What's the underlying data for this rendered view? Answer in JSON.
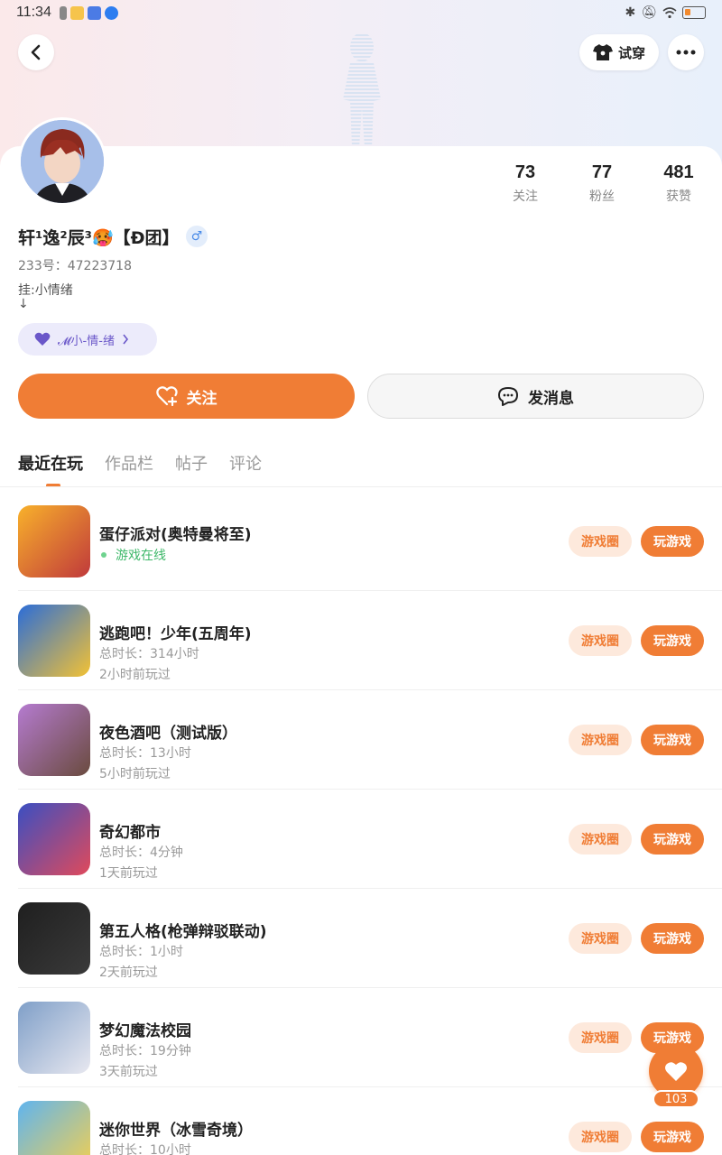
{
  "status_bar": {
    "time": "11:34"
  },
  "header": {
    "tryon_label": "试穿"
  },
  "profile": {
    "stats": [
      {
        "value": "73",
        "label": "关注"
      },
      {
        "value": "77",
        "label": "粉丝"
      },
      {
        "value": "481",
        "label": "获赞"
      }
    ],
    "username": "轩¹逸²辰³🥵【Đ团】",
    "gender_symbol": "♂",
    "uid_label": "233号：",
    "uid": "47223718",
    "bio_line1": "挂:小情绪",
    "bio_line2": "↓",
    "tag": "𝓜小-情-绪"
  },
  "actions": {
    "follow_label": "关注",
    "message_label": "发消息"
  },
  "tabs": [
    {
      "label": "最近在玩",
      "active": true
    },
    {
      "label": "作品栏",
      "active": false
    },
    {
      "label": "帖子",
      "active": false
    },
    {
      "label": "评论",
      "active": false
    }
  ],
  "games": [
    {
      "title": "蛋仔派对(奥特曼将至)",
      "online": "游戏在线",
      "sub1": "",
      "sub2": "",
      "colors": [
        "#f8b12b",
        "#c0393b"
      ]
    },
    {
      "title": "逃跑吧！少年(五周年)",
      "online": "",
      "sub1": "总时长：314小时",
      "sub2": "2小时前玩过",
      "colors": [
        "#2b6dd8",
        "#f3c234"
      ]
    },
    {
      "title": "夜色酒吧（测试版）",
      "online": "",
      "sub1": "总时长：13小时",
      "sub2": "5小时前玩过",
      "colors": [
        "#b57bd0",
        "#6a4b3e"
      ]
    },
    {
      "title": "奇幻都市",
      "online": "",
      "sub1": "总时长：4分钟",
      "sub2": "1天前玩过",
      "colors": [
        "#3a4fc2",
        "#e04a5b"
      ]
    },
    {
      "title": "第五人格(枪弹辩驳联动)",
      "online": "",
      "sub1": "总时长：1小时",
      "sub2": "2天前玩过",
      "colors": [
        "#1f1f1f",
        "#3a3a3a"
      ]
    },
    {
      "title": "梦幻魔法校园",
      "online": "",
      "sub1": "总时长：19分钟",
      "sub2": "3天前玩过",
      "colors": [
        "#7f9fc8",
        "#e8e8f0"
      ]
    },
    {
      "title": "迷你世界（冰雪奇境）",
      "online": "",
      "sub1": "总时长：10小时",
      "sub2": "",
      "colors": [
        "#5fb4ef",
        "#f6d04d"
      ]
    }
  ],
  "game_buttons": {
    "circle_label": "游戏圈",
    "play_label": "玩游戏"
  },
  "fab": {
    "count": "103"
  },
  "colors": {
    "accent": "#f07d35",
    "accent_light": "#fde9dc",
    "online_green": "#3fb86a"
  }
}
